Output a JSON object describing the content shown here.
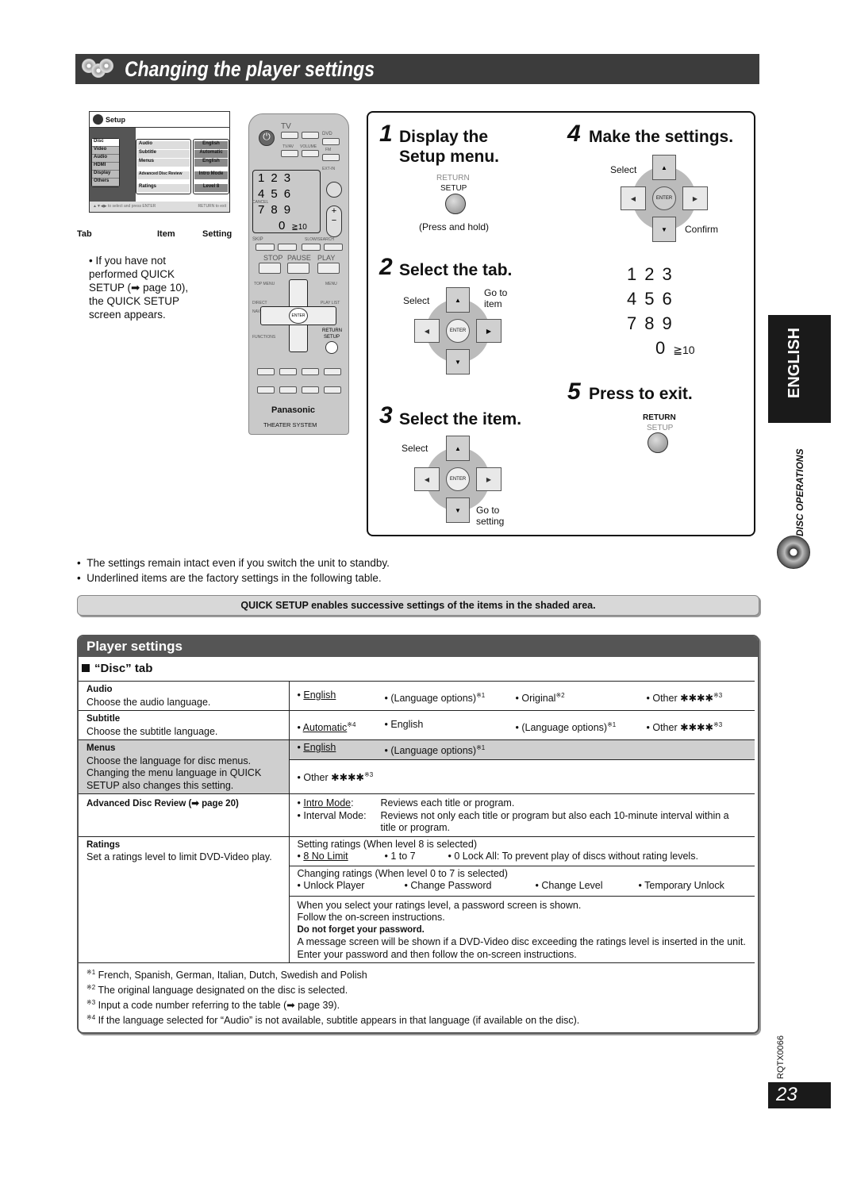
{
  "title": "Changing the player settings",
  "setup_screen": {
    "header": "Setup",
    "tabs": [
      "Disc",
      "Video",
      "Audio",
      "HDMI",
      "Display",
      "Others"
    ],
    "items": [
      "Audio",
      "Subtitle",
      "Menus",
      "Advanced Disc Review",
      "Ratings"
    ],
    "settings": [
      "English",
      "Automatic",
      "English",
      "Intro Mode",
      "Level 8"
    ],
    "footer_left": "▲▼◀▶ to select and press ENTER",
    "footer_right": "RETURN to exit",
    "labels": {
      "tab": "Tab",
      "item": "Item",
      "setting": "Setting"
    }
  },
  "intro_note": "If you have not performed QUICK SETUP (➡ page 10), the QUICK SETUP screen appears.",
  "remote": {
    "tv": "TV",
    "dvd": "DVD",
    "fm": "FM",
    "tvav": "TV/AV",
    "volume": "VOLUME",
    "ext_in": "EXT-IN",
    "numbers": [
      "1",
      "2",
      "3",
      "4",
      "5",
      "6",
      "7",
      "8",
      "9",
      "0",
      "≧10"
    ],
    "cancel": "CANCEL",
    "skip": "SKIP",
    "slow_search": "SLOW/SEARCH",
    "stop": "STOP",
    "pause": "PAUSE",
    "play": "PLAY",
    "top_menu": "TOP MENU",
    "menu": "MENU",
    "direct_navigator": "DIRECT NAVIGATOR",
    "play_list": "PLAY LIST",
    "enter": "ENTER",
    "functions": "FUNCTIONS",
    "return": "RETURN",
    "setup": "SETUP",
    "brand": "Panasonic",
    "model": "THEATER SYSTEM"
  },
  "steps": [
    {
      "num": "1",
      "title": "Display the Setup menu.",
      "return": "RETURN",
      "setup": "SETUP",
      "caption": "(Press and hold)"
    },
    {
      "num": "2",
      "title": "Select the tab.",
      "select": "Select",
      "goto": "Go to item"
    },
    {
      "num": "3",
      "title": "Select the item.",
      "select": "Select",
      "goto": "Go to setting"
    },
    {
      "num": "4",
      "title": "Make the settings.",
      "select": "Select",
      "confirm": "Confirm"
    },
    {
      "num": "5",
      "title": "Press to exit.",
      "return": "RETURN",
      "setup": "SETUP"
    }
  ],
  "numpad": [
    "1",
    "2",
    "3",
    "4",
    "5",
    "6",
    "7",
    "8",
    "9",
    "0",
    "≧10"
  ],
  "side": {
    "language": "ENGLISH",
    "section": "DISC OPERATIONS",
    "code": "RQTX0066",
    "page": "23"
  },
  "bullets": [
    "The settings remain intact even if you switch the unit to standby.",
    "Underlined items are the factory settings in the following table."
  ],
  "quick_setup_note": "QUICK SETUP enables successive settings of the items in the shaded area.",
  "player_settings": {
    "header": "Player settings",
    "tab": "“Disc” tab",
    "rows": {
      "audio": {
        "name": "Audio",
        "desc": "Choose the audio language.",
        "opts": [
          "English",
          "(Language options)",
          "Original",
          "Other ✱✱✱✱"
        ],
        "marks": [
          "",
          "※1",
          "※2",
          "※3"
        ]
      },
      "subtitle": {
        "name": "Subtitle",
        "desc": "Choose the subtitle language.",
        "opts": [
          "Automatic",
          "English",
          "(Language options)",
          "Other ✱✱✱✱"
        ],
        "marks": [
          "※4",
          "",
          "※1",
          "※3"
        ]
      },
      "menus": {
        "name": "Menus",
        "desc": "Choose the language for disc menus. Changing the menu language in QUICK SETUP also changes this setting.",
        "opts": [
          "English",
          "(Language options)",
          "Other ✱✱✱✱"
        ],
        "marks": [
          "",
          "※1",
          "※3"
        ]
      },
      "adr": {
        "name": "Advanced Disc Review (➡ page 20)",
        "opts": [
          {
            "label": "Intro Mode",
            "desc": "Reviews each title or program."
          },
          {
            "label": "Interval Mode",
            "desc": "Reviews not only each title or program but also each 10-minute interval within a title or program."
          }
        ]
      },
      "ratings": {
        "name": "Ratings",
        "desc": "Set a ratings level to limit DVD-Video play.",
        "setting_head": "Setting ratings (When level 8 is selected)",
        "setting_opts": [
          "8 No Limit",
          "1 to 7",
          "0 Lock All: To prevent play of discs without rating levels."
        ],
        "changing_head": "Changing ratings (When level 0 to 7 is selected)",
        "changing_opts": [
          "Unlock Player",
          "Change Password",
          "Change Level",
          "Temporary Unlock"
        ],
        "info1": "When you select your ratings level, a password screen is shown.",
        "info2": "Follow the on-screen instructions.",
        "info_bold": "Do not forget your password.",
        "info3": "A message screen will be shown if a DVD-Video disc exceeding the ratings level is inserted in the unit.",
        "info4": "Enter your password and then follow the on-screen instructions."
      }
    },
    "footnotes": [
      {
        "mark": "※1",
        "text": "French, Spanish, German, Italian, Dutch, Swedish and Polish"
      },
      {
        "mark": "※2",
        "text": "The original language designated on the disc is selected."
      },
      {
        "mark": "※3",
        "text": "Input a code number referring to the table (➡ page 39)."
      },
      {
        "mark": "※4",
        "text": "If the language selected for “Audio” is not available, subtitle appears in that language (if available on the disc)."
      }
    ]
  }
}
